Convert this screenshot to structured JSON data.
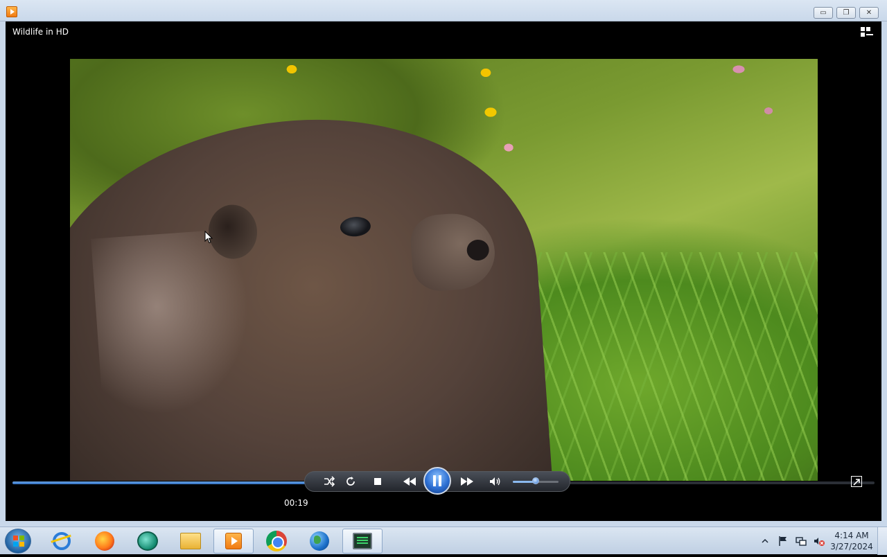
{
  "window": {
    "title": "Wildlife in HD",
    "minimize_label": "▭",
    "maximize_label": "❐",
    "close_label": "✕"
  },
  "player": {
    "current_time": "00:19",
    "progress_fraction": 0.64,
    "volume_fraction": 0.5,
    "accent_color": "#2f6dbd"
  },
  "taskbar": {
    "items": [
      {
        "name": "Internet Explorer",
        "icon": "ie-icon"
      },
      {
        "name": "Firefox",
        "icon": "firefox-icon"
      },
      {
        "name": "Messenger",
        "icon": "bubble-icon"
      },
      {
        "name": "Windows Explorer",
        "icon": "folder-icon"
      },
      {
        "name": "Windows Media Player",
        "icon": "wmp-icon",
        "active": true
      },
      {
        "name": "Google Chrome",
        "icon": "chrome-icon"
      },
      {
        "name": "Globe",
        "icon": "globe-icon"
      },
      {
        "name": "Task Manager",
        "icon": "monitor-icon",
        "active": true
      }
    ],
    "clock_time": "4:14 AM",
    "clock_date": "3/27/2024"
  }
}
